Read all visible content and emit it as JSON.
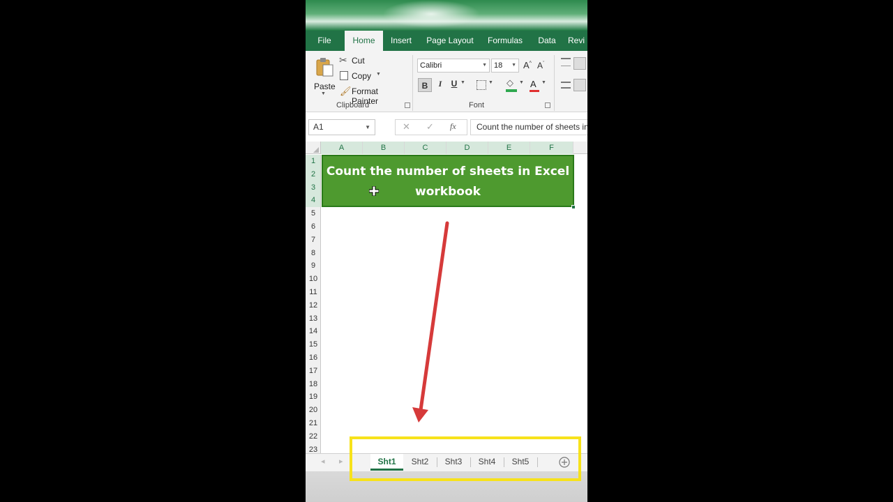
{
  "ribbon": {
    "tabs": [
      "File",
      "Home",
      "Insert",
      "Page Layout",
      "Formulas",
      "Data",
      "Revi"
    ],
    "active_tab": "Home",
    "clipboard": {
      "paste_label": "Paste",
      "cut_label": "Cut",
      "copy_label": "Copy",
      "format_painter_label": "Format Painter",
      "group_label": "Clipboard"
    },
    "font": {
      "font_name": "Calibri",
      "font_size": "18",
      "bold": "B",
      "italic": "I",
      "underline": "U",
      "grow": "A",
      "shrink": "A",
      "color_letter": "A",
      "group_label": "Font"
    }
  },
  "formula_bar": {
    "name_box": "A1",
    "fx": "fx",
    "formula_text": "Count the number of sheets in Excel workbook"
  },
  "grid": {
    "columns": [
      "A",
      "B",
      "C",
      "D",
      "E",
      "F"
    ],
    "rows": [
      "1",
      "2",
      "3",
      "4",
      "5",
      "6",
      "7",
      "8",
      "9",
      "10",
      "11",
      "12",
      "13",
      "14",
      "15",
      "16",
      "17",
      "18",
      "19",
      "20",
      "21",
      "22",
      "23"
    ],
    "banner_line1": "Count the number of sheets in Excel",
    "banner_line2": "workbook",
    "banner_color": "#4e9a2f"
  },
  "sheets": {
    "tabs": [
      "Sht1",
      "Sht2",
      "Sht3",
      "Sht4",
      "Sht5"
    ],
    "active": "Sht1"
  },
  "overlay": {
    "highlight_color": "#f7e21b",
    "arrow_color": "#d63a3a"
  }
}
